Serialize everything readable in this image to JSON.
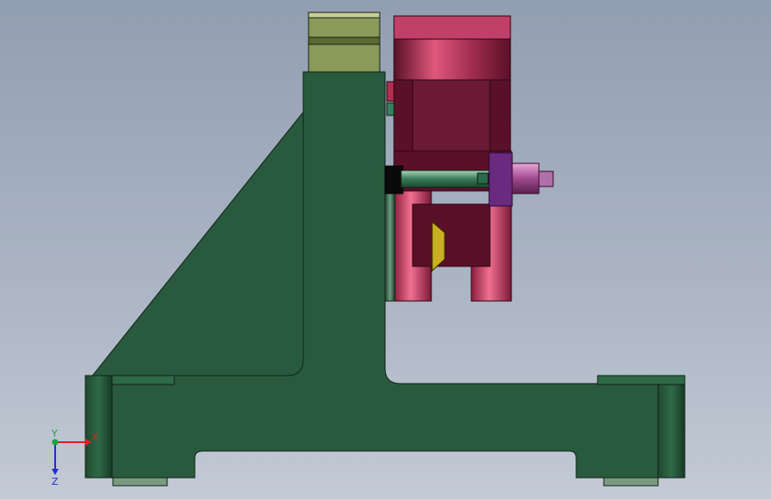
{
  "viewport": {
    "background_top": "#929eb1",
    "background_bottom": "#c3cad5"
  },
  "colors": {
    "base_green": "#2a5a3d",
    "base_green_dark": "#1f4a30",
    "base_edge": "#0f2318",
    "block_olive": "#8a9a5a",
    "clamp_crimson": "#6a1a34",
    "clamp_pink": "#c84a6c",
    "knob_purple": "#9a4a8a",
    "wedge_yellow": "#c8b020",
    "axis_x": "#e02020",
    "axis_y": "#20a040",
    "axis_z": "#2030d0"
  },
  "parts": [
    {
      "name": "base-plate",
      "icon": "base-plate-icon"
    },
    {
      "name": "support-rib",
      "icon": "support-rib-icon"
    },
    {
      "name": "vertical-column",
      "icon": "column-icon"
    },
    {
      "name": "top-guide-block",
      "icon": "block-icon"
    },
    {
      "name": "clamp-body",
      "icon": "clamp-icon"
    },
    {
      "name": "clamp-screw",
      "icon": "screw-icon"
    },
    {
      "name": "adjust-nut",
      "icon": "nut-icon"
    },
    {
      "name": "locating-wedge",
      "icon": "wedge-icon"
    }
  ],
  "triad": {
    "x_label": "X",
    "y_label": "Y",
    "z_label": "Z"
  }
}
